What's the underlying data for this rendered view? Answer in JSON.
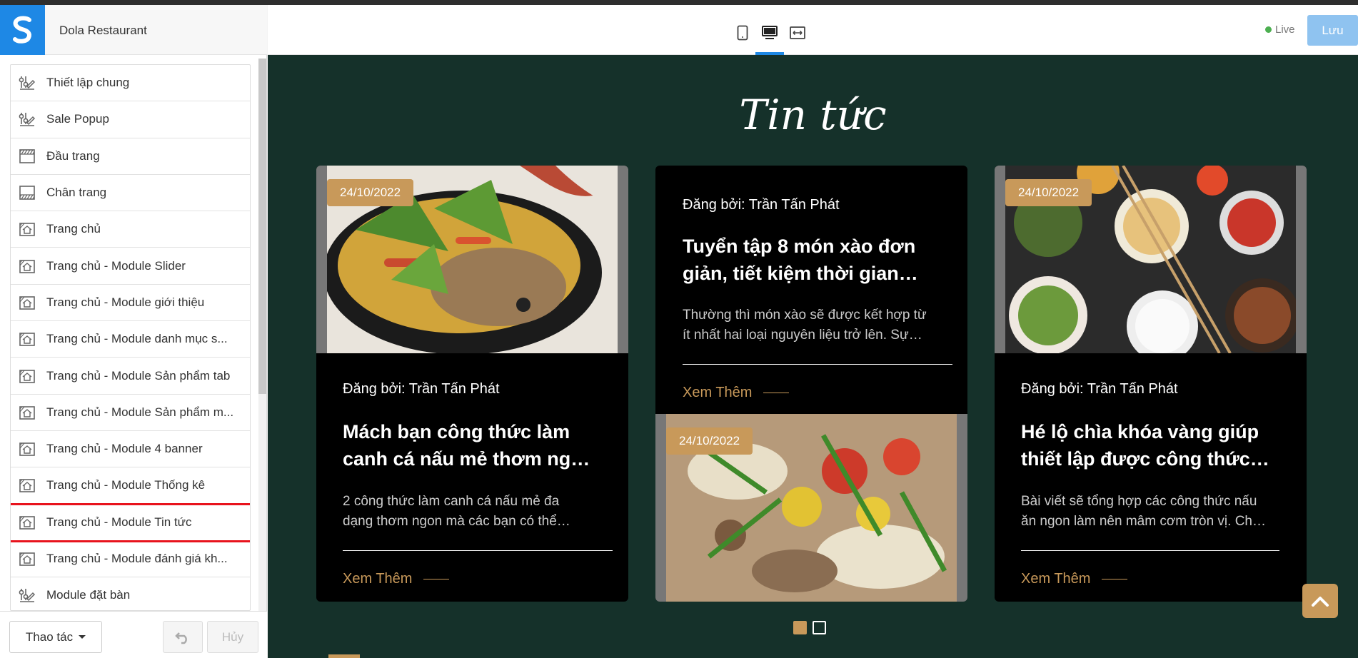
{
  "app": {
    "name": "Dola Restaurant",
    "live_label": "Live",
    "save_label": "Lưu"
  },
  "sidebar": {
    "items": [
      {
        "label": "Thiết lập chung",
        "icon": "settings-sliders-icon"
      },
      {
        "label": "Sale Popup",
        "icon": "settings-sliders-icon"
      },
      {
        "label": "Đầu trang",
        "icon": "header-layout-icon"
      },
      {
        "label": "Chân trang",
        "icon": "footer-layout-icon"
      },
      {
        "label": "Trang chủ",
        "icon": "home-page-icon"
      },
      {
        "label": "Trang chủ - Module Slider",
        "icon": "home-page-icon"
      },
      {
        "label": "Trang chủ - Module giới thiệu",
        "icon": "home-page-icon"
      },
      {
        "label": "Trang chủ - Module danh mục s...",
        "icon": "home-page-icon"
      },
      {
        "label": "Trang chủ - Module Sản phẩm tab",
        "icon": "home-page-icon"
      },
      {
        "label": "Trang chủ - Module Sản phẩm m...",
        "icon": "home-page-icon"
      },
      {
        "label": "Trang chủ - Module 4 banner",
        "icon": "home-page-icon"
      },
      {
        "label": "Trang chủ - Module Thống kê",
        "icon": "home-page-icon"
      },
      {
        "label": "Trang chủ - Module Tin tức",
        "icon": "home-page-icon",
        "active": true
      },
      {
        "label": "Trang chủ - Module đánh giá kh...",
        "icon": "home-page-icon"
      },
      {
        "label": "Module đặt bàn",
        "icon": "settings-sliders-icon"
      }
    ],
    "actions_label": "Thao tác",
    "cancel_label": "Hủy"
  },
  "preview": {
    "section_title": "Tin tức",
    "cards": [
      {
        "date": "24/10/2022",
        "author": "Đăng bởi: Trần Tấn Phát",
        "title_line1": "Mách bạn công thức làm",
        "title_line2": "canh cá nấu mẻ thơm ng…",
        "desc_line1": "2 công thức làm canh cá nấu mẻ đa",
        "desc_line2": "dạng thơm ngon mà các bạn có thể…",
        "more": "Xem Thêm"
      },
      {
        "date": "24/10/2022",
        "author": "Đăng bởi: Trần Tấn Phát",
        "title_line1": "Tuyển tập 8 món xào đơn",
        "title_line2": "giản, tiết kiệm thời gian…",
        "desc_line1": "Thường thì món xào sẽ được kết hợp từ",
        "desc_line2": "ít nhất hai loại nguyên liệu trở lên. Sự…",
        "more": "Xem Thêm"
      },
      {
        "date": "24/10/2022",
        "author": "Đăng bởi: Trần Tấn Phát",
        "title_line1": "Hé lộ chìa khóa vàng giúp",
        "title_line2": "thiết lập được công thức…",
        "desc_line1": "Bài viết sẽ tổng hợp các công thức nấu",
        "desc_line2": "ăn ngon làm nên mâm cơm tròn vị. Ch…",
        "more": "Xem Thêm"
      }
    ],
    "pagination_active": 1
  },
  "colors": {
    "accent": "#c8995a",
    "preview_bg": "#15312a",
    "brand_blue": "#1e88e5",
    "highlight_red": "#e8131d"
  }
}
